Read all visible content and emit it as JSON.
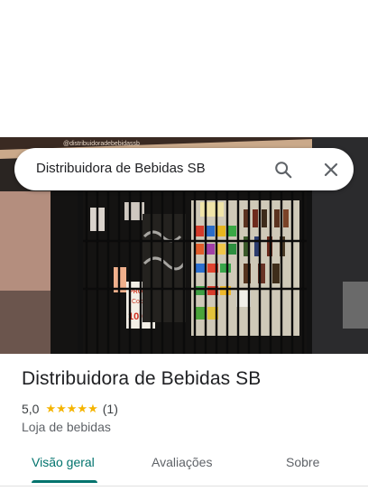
{
  "search": {
    "query": "Distribuidora de Bebidas SB"
  },
  "place": {
    "name": "Distribuidora de Bebidas SB",
    "rating": "5,0",
    "stars": "★★★★★",
    "review_count": "(1)",
    "category": "Loja de bebidas"
  },
  "photo": {
    "sign_top": "@distribuidoradebebidassb",
    "promo_line1": "PROMOÇÃO",
    "promo_line2": "Copão",
    "promo_price": "10,00"
  },
  "tabs": [
    {
      "label": "Visão geral",
      "active": true
    },
    {
      "label": "Avaliações",
      "active": false
    },
    {
      "label": "Sobre",
      "active": false
    }
  ],
  "colors": {
    "accent": "#01736d",
    "star": "#f5b400"
  },
  "icons": {
    "search": "search-icon",
    "close": "close-icon"
  }
}
